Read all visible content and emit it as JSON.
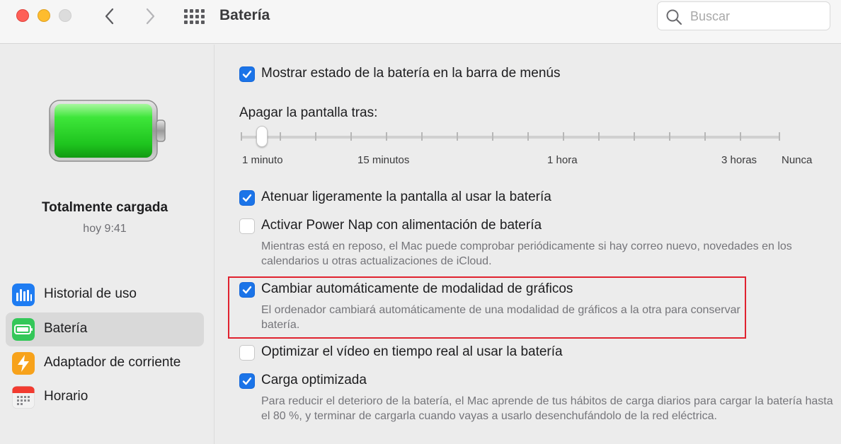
{
  "window": {
    "title": "Batería",
    "search_placeholder": "Buscar"
  },
  "sidebar": {
    "status_title": "Totalmente cargada",
    "status_time": "hoy 9:41",
    "items": [
      {
        "label": "Historial de uso",
        "icon": "bar-chart-icon",
        "selected": false
      },
      {
        "label": "Batería",
        "icon": "battery-icon",
        "selected": true
      },
      {
        "label": "Adaptador de corriente",
        "icon": "lightning-icon",
        "selected": false
      },
      {
        "label": "Horario",
        "icon": "calendar-icon",
        "selected": false
      }
    ]
  },
  "main": {
    "show_status": {
      "label": "Mostrar estado de la batería en la barra de menús",
      "checked": true
    },
    "display_off": {
      "label": "Apagar la pantalla tras:",
      "value": "1 minuto",
      "tick_labels": [
        "1 minuto",
        "15 minutos",
        "1 hora",
        "3 horas",
        "Nunca"
      ]
    },
    "dim_display": {
      "label": "Atenuar ligeramente la pantalla al usar la batería",
      "checked": true
    },
    "power_nap": {
      "label": "Activar Power Nap con alimentación de batería",
      "checked": false,
      "description": "Mientras está en reposo, el Mac puede comprobar periódicamente si hay correo nuevo, novedades en los calendarios u otras actualizaciones de iCloud."
    },
    "graphics_switching": {
      "label": "Cambiar automáticamente de modalidad de gráficos",
      "checked": true,
      "description": "El ordenador cambiará automáticamente de una modalidad de gráficos a la otra para conservar batería."
    },
    "video_streaming": {
      "label": "Optimizar el vídeo en tiempo real al usar la batería",
      "checked": false
    },
    "optimized_charging": {
      "label": "Carga optimizada",
      "checked": true,
      "description": "Para reducir el deterioro de la batería, el Mac aprende de tus hábitos de carga diarios para cargar la batería hasta el 80 %, y terminar de cargarla cuando vayas a usarlo desenchufándolo de la red eléctrica."
    }
  },
  "colors": {
    "accent": "#1b74e8",
    "highlight_box": "#e0222f",
    "battery_fill": "#2ed12e"
  }
}
